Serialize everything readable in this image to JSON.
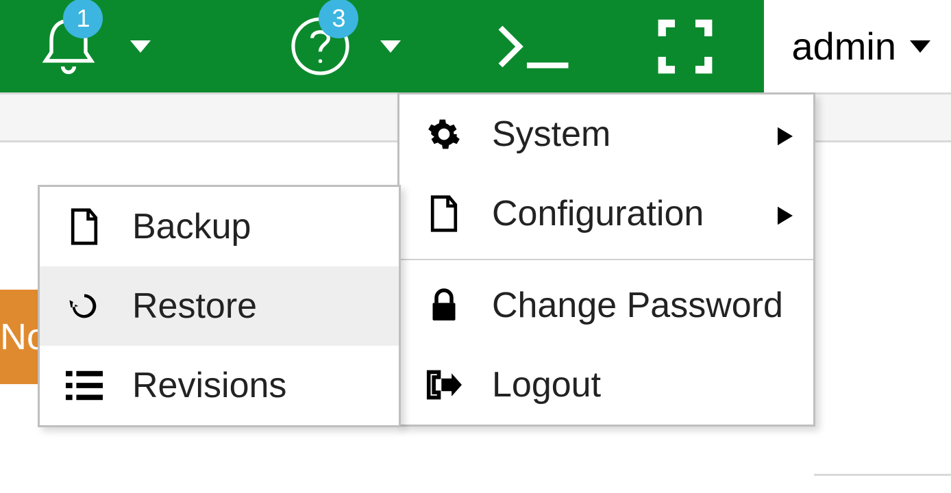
{
  "topbar": {
    "notifications_badge": "1",
    "help_badge": "3",
    "user_label": "admin"
  },
  "main_menu": {
    "system": "System",
    "configuration": "Configuration",
    "change_password": "Change Password",
    "logout": "Logout"
  },
  "sub_menu": {
    "backup": "Backup",
    "restore": "Restore",
    "revisions": "Revisions"
  },
  "fragment": "No"
}
